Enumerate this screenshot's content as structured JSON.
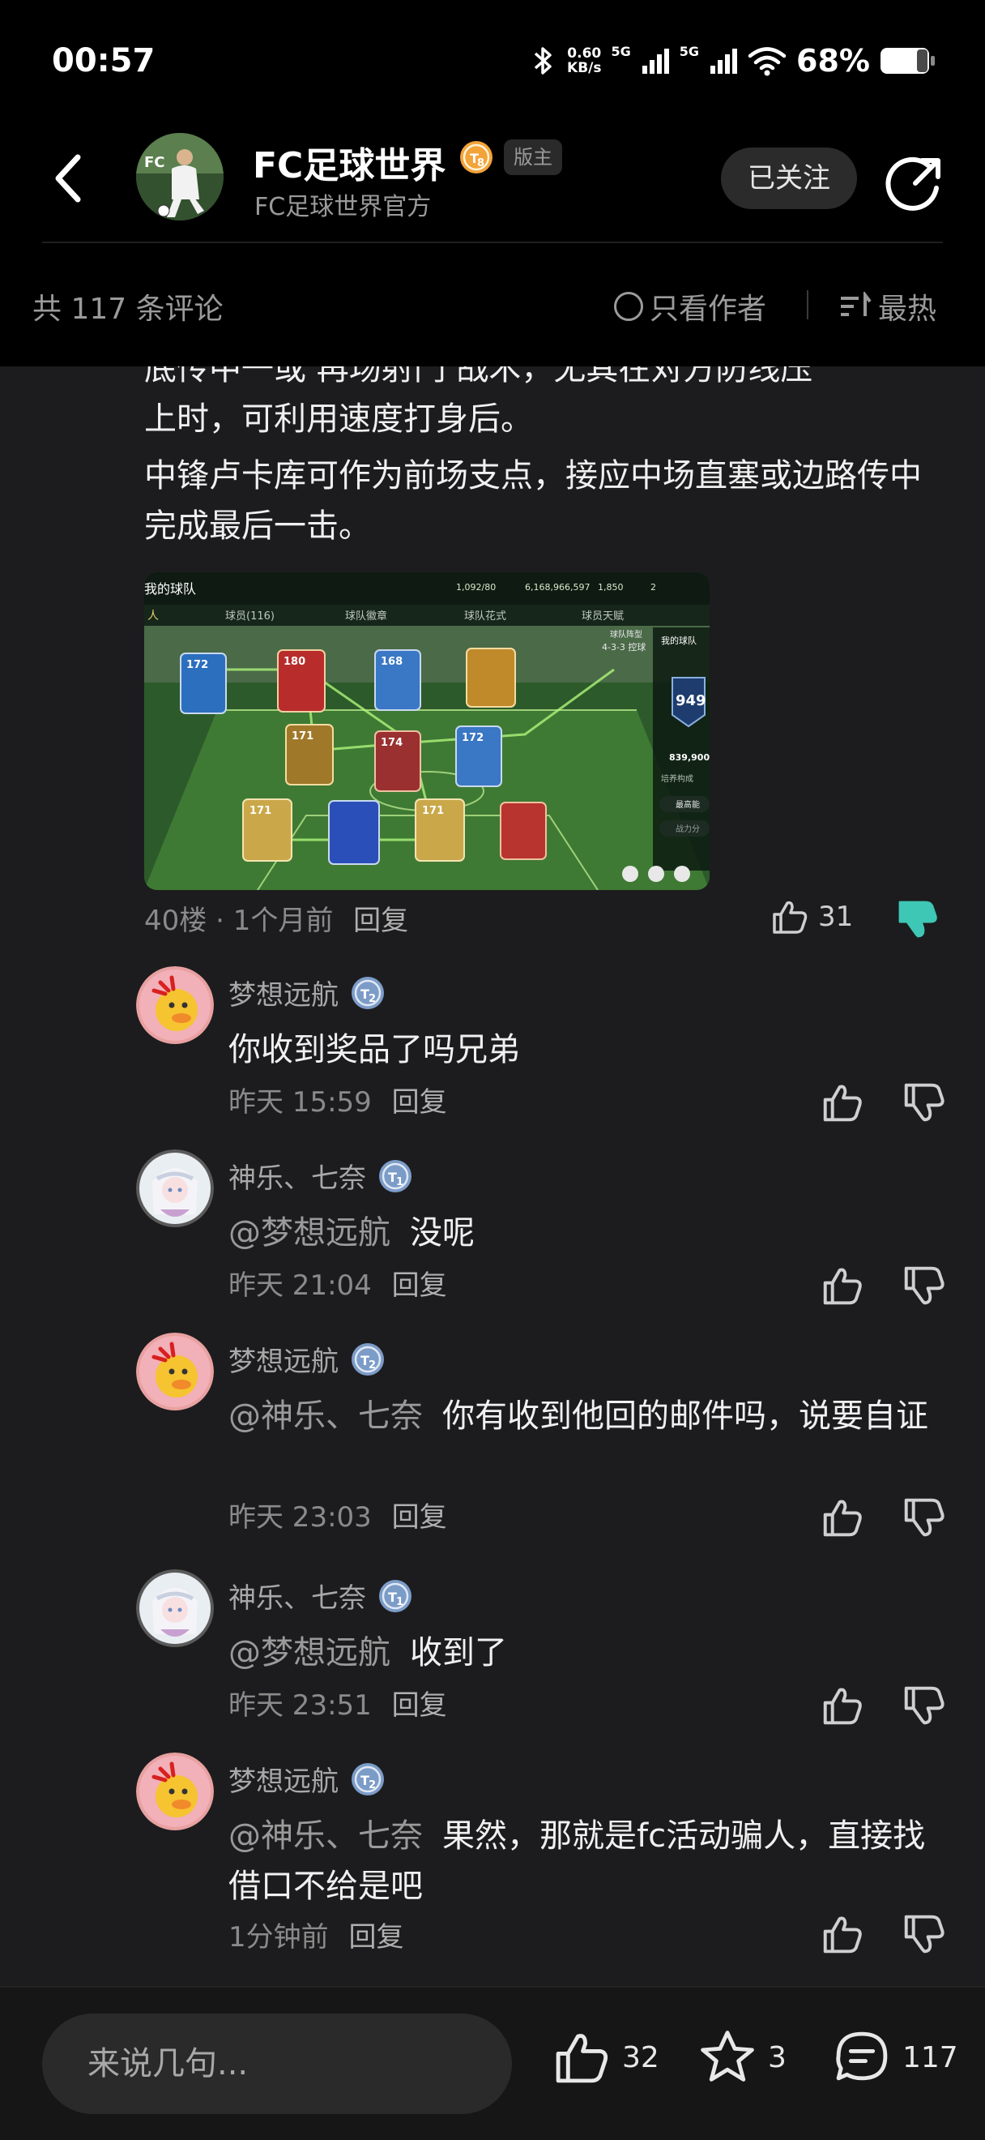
{
  "status_bar": {
    "time": "00:57",
    "net_speed_value": "0.60",
    "net_speed_unit": "KB/s",
    "sim1": "5G",
    "sim2": "5G",
    "battery": "68%"
  },
  "header": {
    "channel_name": "FC足球世界",
    "level": "8",
    "role_badge": "版主",
    "subtitle": "FC足球世界官方",
    "follow_label": "已关注"
  },
  "subbar": {
    "comment_count": "共 117 条评论",
    "author_only": "只看作者",
    "sort": "最热"
  },
  "post": {
    "text_partial_top": "底传中一或 再场射门 战术，无其在对方防线压",
    "text_line2": "上时，可利用速度打身后。",
    "text_para2": "中锋卢卡库可作为前场支点，接应中场直塞或边路传中完成最后一击。",
    "image": {
      "title": "我的球队",
      "tabs": [
        "人",
        "球员(116)",
        "球队徽章",
        "球队花式",
        "球员天赋"
      ],
      "stats": [
        "1,092/80",
        "6,168,966,597",
        "1,850",
        "2"
      ],
      "formation_label": "球队阵型",
      "formation": "4-3-3 控球",
      "panel_title": "我的球队",
      "ovr": "949",
      "coins": "839,900",
      "panel_sub": "培养构成",
      "panel_btn1": "最高能",
      "panel_btn2": "战力分",
      "card_ratings": [
        "172",
        "180",
        "168",
        "",
        "171",
        "174",
        "172",
        "171",
        "",
        "171",
        ""
      ]
    },
    "floor": "40楼",
    "time": "1个月前",
    "reply": "回复",
    "likes": "31"
  },
  "replies": [
    {
      "name": "梦想远航",
      "level": "2",
      "mention": "",
      "text": "你收到奖品了吗兄弟",
      "time": "昨天 15:59",
      "reply": "回复"
    },
    {
      "name": "神乐、七奈",
      "level": "1",
      "mention": "@梦想远航",
      "text": "没呢",
      "time": "昨天 21:04",
      "reply": "回复"
    },
    {
      "name": "梦想远航",
      "level": "2",
      "mention": "@神乐、七奈",
      "text": "你有收到他回的邮件吗，说要自证",
      "time": "昨天 23:03",
      "reply": "回复"
    },
    {
      "name": "神乐、七奈",
      "level": "1",
      "mention": "@梦想远航",
      "text": "收到了",
      "time": "昨天 23:51",
      "reply": "回复"
    },
    {
      "name": "梦想远航",
      "level": "2",
      "mention": "@神乐、七奈",
      "text": "果然，那就是fc活动骗人，直接找借口不给是吧",
      "time": "1分钟前",
      "reply": "回复"
    }
  ],
  "bottom_bar": {
    "input_placeholder": "来说几句...",
    "likes": "32",
    "favorites": "3",
    "comments": "117"
  },
  "colors": {
    "background": "#1c1c1e",
    "header": "#000000",
    "accent_teal": "#3ec7b4",
    "level_orange": "#f2a33a",
    "level_blue": "#7c9cc8"
  }
}
